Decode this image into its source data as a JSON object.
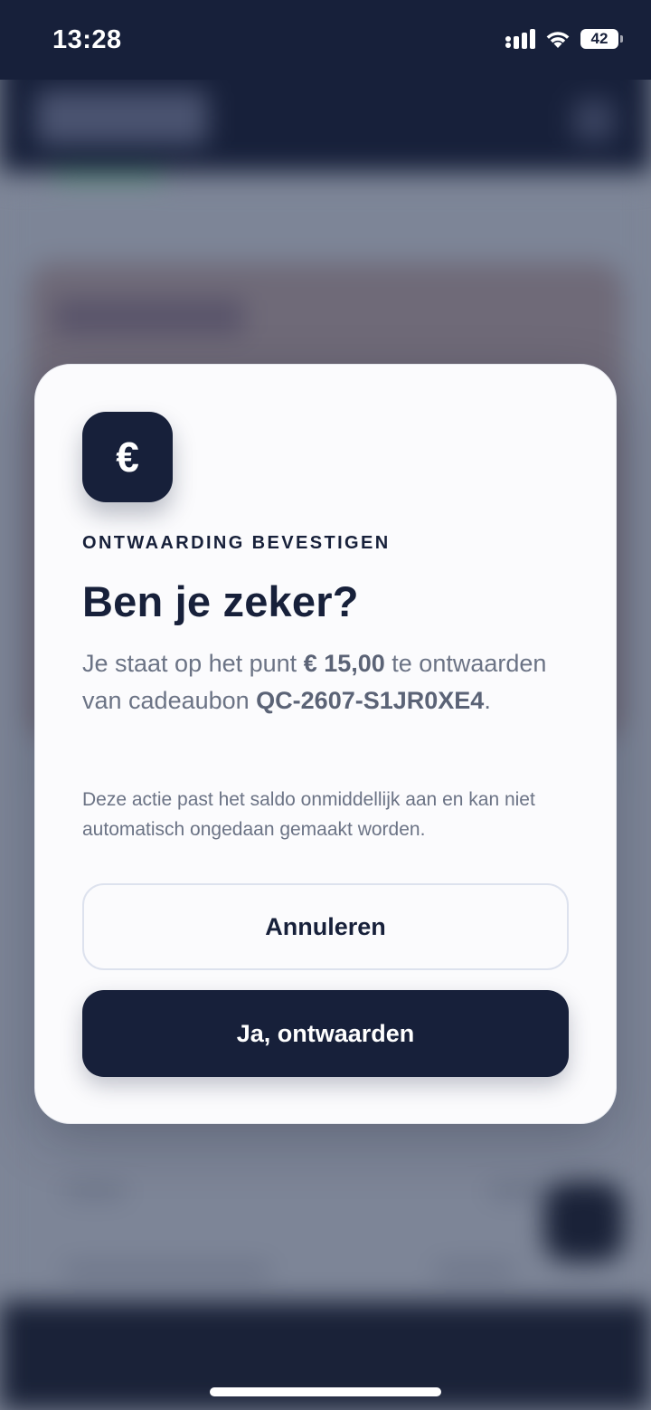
{
  "status_bar": {
    "time": "13:28",
    "battery": "42",
    "icons": [
      "signal-icon",
      "wifi-icon",
      "battery-icon"
    ]
  },
  "dialog": {
    "icon": "€",
    "eyebrow": "ONTWAARDING BEVESTIGEN",
    "title": "Ben je zeker?",
    "message": {
      "prefix": "Je staat op het punt ",
      "amount": "€ 15,00",
      "middle": " te ontwaarden van cadeaubon ",
      "code": "QC-2607-S1JR0XE4",
      "suffix": "."
    },
    "note": "Deze actie past het saldo onmiddellijk aan en kan niet automatisch ongedaan gemaakt worden.",
    "cancel_label": "Annuleren",
    "confirm_label": "Ja, ontwaarden"
  },
  "colors": {
    "primary": "#17203a",
    "dialog_bg": "#fbfbfd",
    "muted_text": "#6b7385",
    "button_border": "#dde2ee"
  }
}
